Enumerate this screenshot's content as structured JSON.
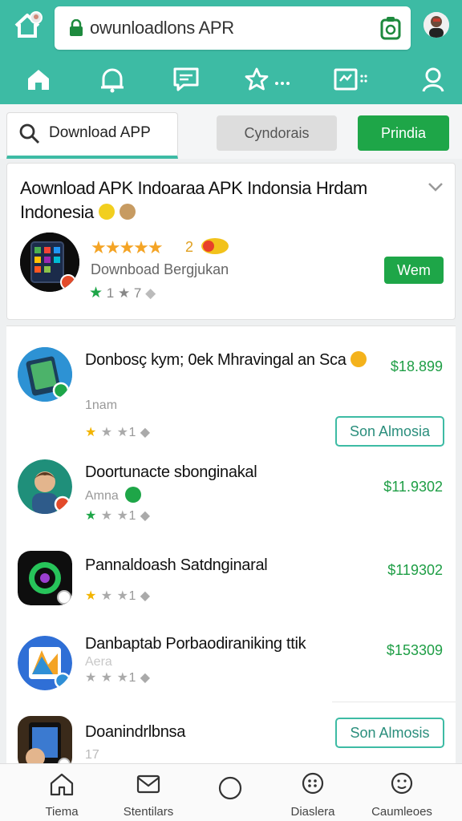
{
  "browser": {
    "url": "owunloadlons APR",
    "colors": {
      "header": "#3dbba4",
      "accent_green": "#1ea648"
    }
  },
  "top_nav": {
    "icons": [
      "home-icon",
      "bell-icon",
      "message-icon",
      "star-icon",
      "grid-icon",
      "user-icon"
    ]
  },
  "search": {
    "value": "Download APP"
  },
  "filters": {
    "chip_gray": "Cyndorais",
    "chip_green": "Prindia"
  },
  "featured": {
    "title": "Aownload APK Indoaraa APK Indonsia Hrdam Indonesia",
    "subtitle": "Downboad Bergjukan",
    "rating_count": "2",
    "rating_line": "1 ★ 7",
    "install_label": "Wem"
  },
  "apps": [
    {
      "name": "Donbosç kym; 0ek Mhravingal an Sca",
      "meta": "1nam",
      "rating": "1",
      "price": "$18.899",
      "action": "Son Almosia"
    },
    {
      "name": "Doortunacte sbonginakal",
      "meta": "Amna",
      "rating": "1",
      "price": "$11.9302",
      "action": ""
    },
    {
      "name": "Pannaldoash Satdnginaral",
      "meta": "",
      "rating": "1",
      "price": "$119302",
      "action": ""
    },
    {
      "name": "Danbaptab Porbaodiraniking ttik",
      "meta": "Aera",
      "rating": "1",
      "price": "$153309",
      "action": ""
    },
    {
      "name": "Doanindrlbnsa",
      "meta": "17",
      "rating": "",
      "price": "",
      "action": "Son Almosis"
    }
  ],
  "bottom_nav": [
    {
      "label": "Tiema",
      "icon": "home-icon"
    },
    {
      "label": "Stentilars",
      "icon": "mail-icon"
    },
    {
      "label": "",
      "icon": "circle-icon"
    },
    {
      "label": "Diaslera",
      "icon": "chat-icon"
    },
    {
      "label": "Caumleoes",
      "icon": "smiley-icon"
    }
  ]
}
